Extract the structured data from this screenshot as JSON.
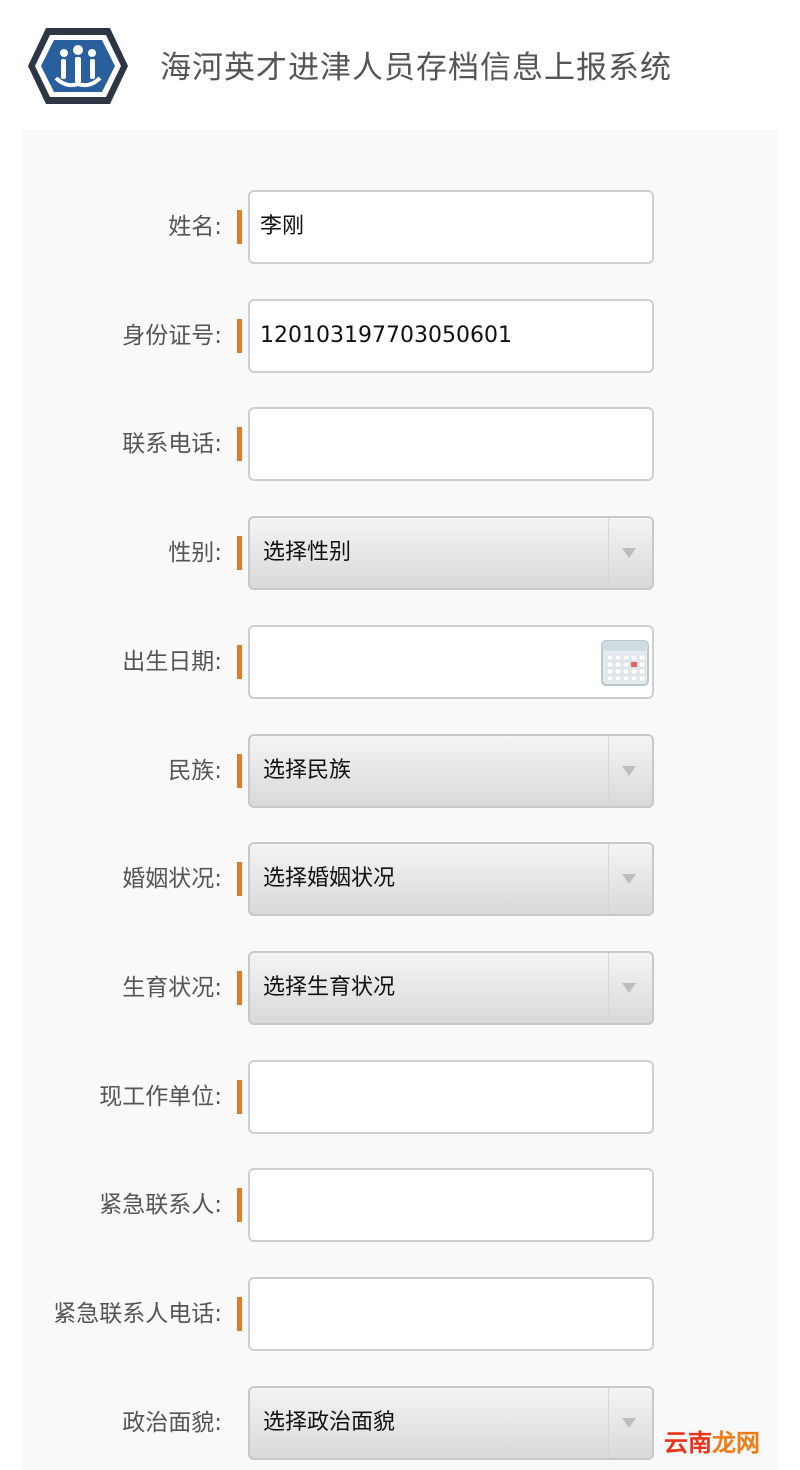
{
  "header": {
    "app_title": "海河英才进津人员存档信息上报系统"
  },
  "form": {
    "rows": [
      {
        "label": "姓名:",
        "kind": "text",
        "value": "李刚",
        "required": true
      },
      {
        "label": "身份证号:",
        "kind": "text",
        "value": "120103197703050601",
        "required": true
      },
      {
        "label": "联系电话:",
        "kind": "text",
        "value": "",
        "required": true
      },
      {
        "label": "性别:",
        "kind": "select",
        "value": "选择性别",
        "required": true
      },
      {
        "label": "出生日期:",
        "kind": "date",
        "value": "",
        "required": true,
        "icon": "calendar-icon"
      },
      {
        "label": "民族:",
        "kind": "select",
        "value": "选择民族",
        "required": true
      },
      {
        "label": "婚姻状况:",
        "kind": "select",
        "value": "选择婚姻状况",
        "required": true
      },
      {
        "label": "生育状况:",
        "kind": "select",
        "value": "选择生育状况",
        "required": true
      },
      {
        "label": "现工作单位:",
        "kind": "text",
        "value": "",
        "required": true
      },
      {
        "label": "紧急联系人:",
        "kind": "text",
        "value": "",
        "required": true
      },
      {
        "label": "紧急联系人电话:",
        "kind": "text",
        "value": "",
        "required": true
      },
      {
        "label": "政治面貌:",
        "kind": "select",
        "value": "选择政治面貌",
        "required": false
      }
    ]
  },
  "watermark": {
    "part1": "云南",
    "part2": "龙网"
  },
  "colors": {
    "required_marker": "#e07b29",
    "logo_blue": "#2a5f9e",
    "logo_dark": "#2d3645",
    "title_text": "#555555"
  }
}
